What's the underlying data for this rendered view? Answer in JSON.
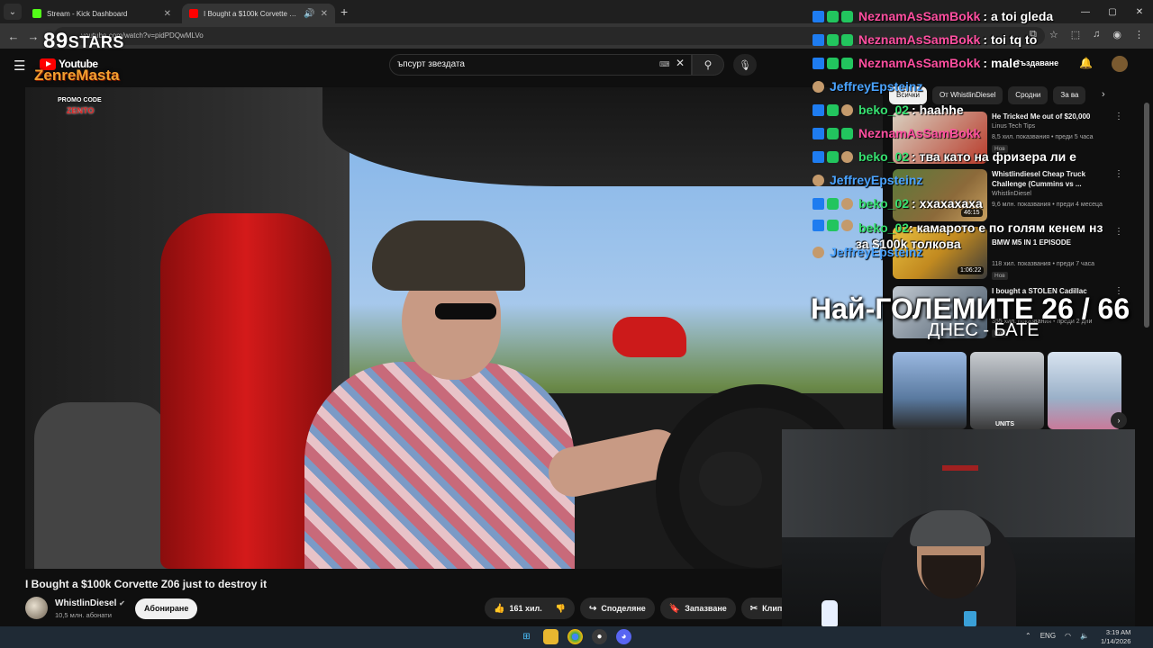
{
  "browser": {
    "tabs": [
      {
        "title": "Stream - Kick Dashboard",
        "favicon_color": "#53fc18"
      },
      {
        "title": "I Bought a $100k Corvette Z06 just to destroy it",
        "favicon_color": "#ff0000"
      }
    ],
    "url": "youtube.com/watch?v=pidPDQwMLVo"
  },
  "youtube": {
    "logo_text": "Youtube",
    "search_query": "ъпсурт звездата",
    "create_label": "Създаване",
    "video": {
      "title": "I Bought a $100k Corvette Z06 just to destroy it",
      "channel": "WhistlinDiesel",
      "subscribers": "10,5 млн. абонати",
      "subscribe_label": "Абониране",
      "likes": "161 хил.",
      "share_label": "Споделяне",
      "save_label": "Запазване",
      "clip_label": "Клип"
    },
    "chips": [
      "Всички",
      "От WhistlinDiesel",
      "Сродни",
      "За ва"
    ],
    "recommendations": [
      {
        "title": "He Tricked Me out of $20,000",
        "channel": "Linus Tech Tips",
        "meta": "8,5 хил. показвания • преди 5 часа",
        "badge": "Нов",
        "duration": "",
        "color": "#b83a2a"
      },
      {
        "title": "Whistlindiesel Cheap Truck Challenge (Cummins vs ...",
        "channel": "WhistlinDiesel",
        "meta": "9,6 млн. показвания • преди 4 месеца",
        "badge": "",
        "duration": "46:15",
        "color": "#8c6a3a"
      },
      {
        "title": "BMW M5 IN 1 EPISODE",
        "channel": "",
        "meta": "118 хил. показвания • преди 7 часа",
        "badge": "Нов",
        "duration": "1:06:22",
        "color": "#c28a20"
      },
      {
        "title": "I bought a STOLEN Cadillac",
        "channel": "",
        "meta": "355 хил. показвания • преди 2 дни",
        "badge": "Нов",
        "duration": "",
        "color": "#4a5a6a"
      }
    ],
    "shorts": [
      {
        "label": "",
        "color": "#5a7aa0"
      },
      {
        "label": "UNITS",
        "color": "#7a8088"
      },
      {
        "label": "",
        "color": "#9ab0c8"
      }
    ]
  },
  "overlay": {
    "logo_number": "89",
    "logo_stars": "STARS",
    "brand": "ZenreMasta",
    "promo_label": "PROMO CODE",
    "promo_code": "ZENTO",
    "counter_title": "Най-ГОЛЕМИТЕ 26 / 66",
    "counter_sub": "ДНЕС - БАТЕ"
  },
  "chat": [
    {
      "user": "NeznamAsSamBokk",
      "text": ": a toi gleda",
      "color_class": "u-pink",
      "badges": [
        "b-blue",
        "b-green",
        "b-green"
      ]
    },
    {
      "user": "NeznamAsSamBokk",
      "text": ": toi tq to",
      "color_class": "u-pink",
      "badges": [
        "b-blue",
        "b-green",
        "b-green"
      ]
    },
    {
      "user": "NeznamAsSamBokk",
      "text": ": male",
      "color_class": "u-pink",
      "badges": [
        "b-blue",
        "b-green",
        "b-green"
      ]
    },
    {
      "user": "JeffreyEpsteinz",
      "text": "",
      "color_class": "u-blue",
      "badges": [
        "b-face"
      ]
    },
    {
      "user": "beko_02",
      "text": ": haahhe",
      "color_class": "u-green",
      "badges": [
        "b-blue",
        "b-green",
        "b-face"
      ]
    },
    {
      "user": "NeznamAsSamBokk",
      "text": "",
      "color_class": "u-pink",
      "badges": [
        "b-blue",
        "b-green",
        "b-green"
      ]
    },
    {
      "user": "beko_02",
      "text": ": тва като на фризера ли е",
      "color_class": "u-green",
      "badges": [
        "b-blue",
        "b-green",
        "b-face"
      ]
    },
    {
      "user": "JeffreyEpsteinz",
      "text": "",
      "color_class": "u-blue",
      "badges": [
        "b-face"
      ]
    },
    {
      "user": "beko_02",
      "text": ": ххахахаха",
      "color_class": "u-green",
      "badges": [
        "b-blue",
        "b-green",
        "b-face"
      ]
    },
    {
      "user": "beko_02",
      "text": ": камарото е по голям кенем нз за $100k толкова",
      "color_class": "u-green",
      "badges": [
        "b-blue",
        "b-green",
        "b-face"
      ]
    },
    {
      "user": "JeffreyEpsteinz",
      "text": "",
      "color_class": "u-blue",
      "badges": [
        "b-face"
      ]
    }
  ],
  "taskbar": {
    "lang": "ENG",
    "time": "3:19 AM",
    "date": "1/14/2026"
  }
}
